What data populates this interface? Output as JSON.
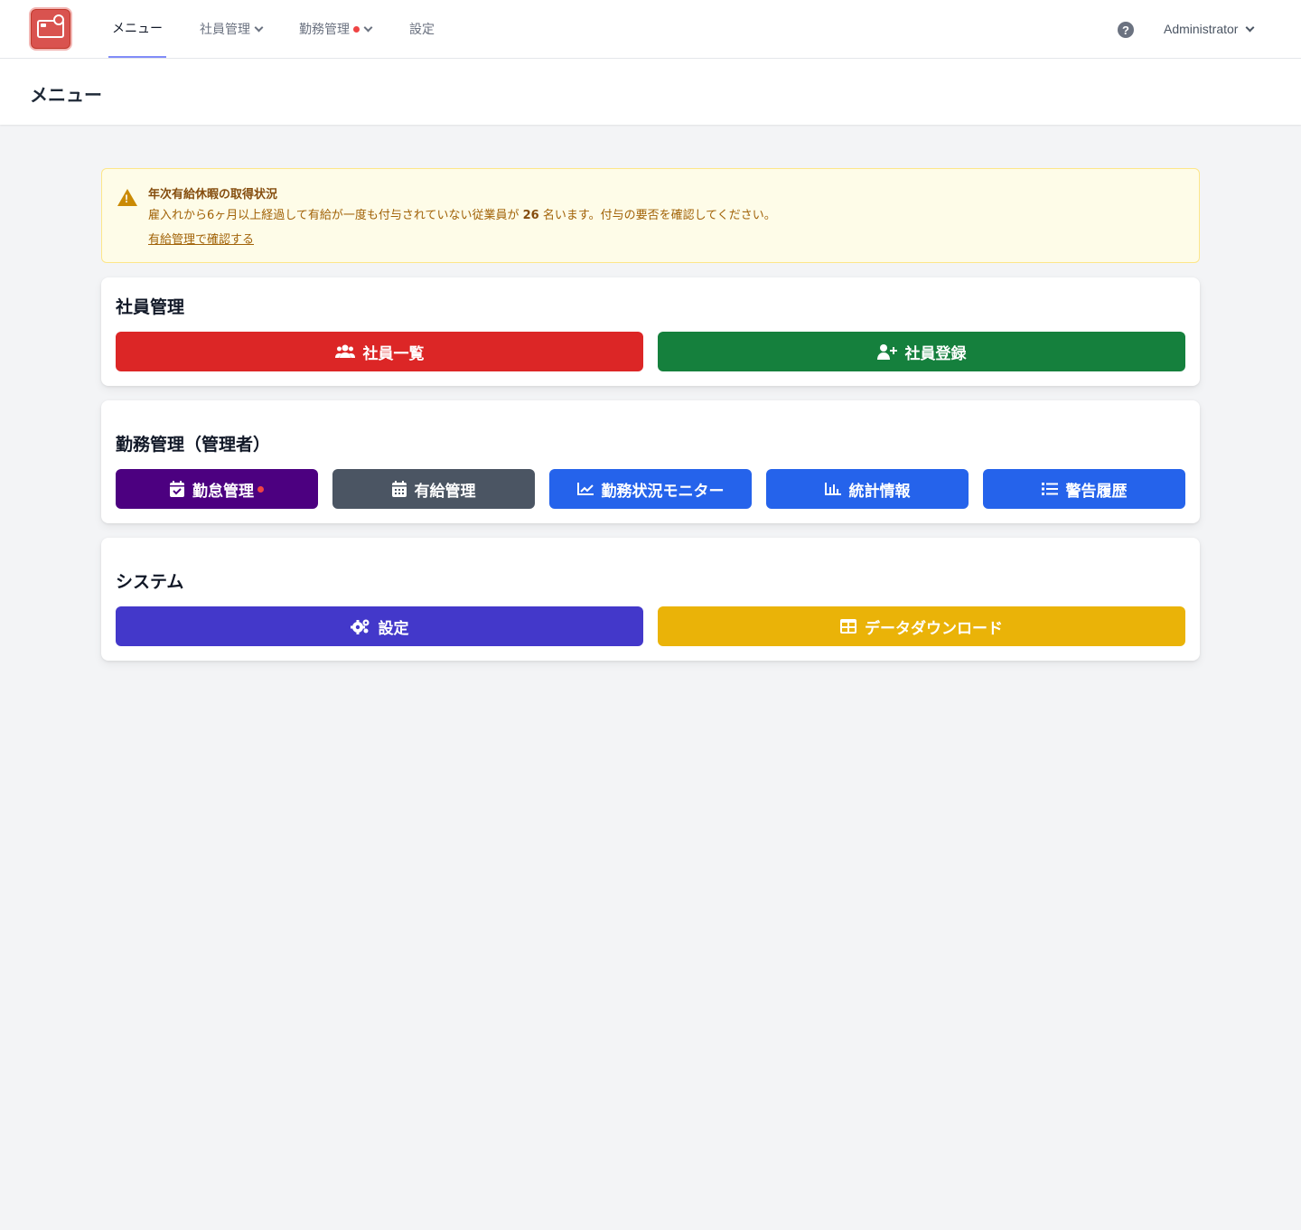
{
  "nav": {
    "logo": "credit-card-lock-logo",
    "items": [
      {
        "label": "メニュー"
      },
      {
        "label": "社員管理"
      },
      {
        "label": "勤務管理"
      },
      {
        "label": "設定"
      }
    ],
    "user": "Administrator",
    "help_glyph": "?"
  },
  "page": {
    "title": "メニュー"
  },
  "alert": {
    "title": "年次有給休暇の取得状況",
    "message_prefix": "雇入れから6ヶ月以上経過して有給が一度も付与されていない従業員が",
    "count": "26",
    "message_suffix": "名います。付与の要否を確認してください。",
    "link": "有給管理で確認する",
    "icon_glyph": "!",
    "color": "#fefce8"
  },
  "sections": {
    "employee": {
      "title": "社員管理",
      "buttons": [
        {
          "label": "社員一覧",
          "icon": "users-icon",
          "color": "#dc2626"
        },
        {
          "label": "社員登録",
          "icon": "user-plus-icon",
          "color": "#15803d"
        }
      ]
    },
    "attendance": {
      "title": "勤務管理（管理者）",
      "buttons": [
        {
          "label": "勤怠管理",
          "icon": "calendar-check-icon",
          "color": "#4c0080"
        },
        {
          "label": "有給管理",
          "icon": "calendar-icon",
          "color": "#4b5563"
        },
        {
          "label": "勤務状況モニター",
          "icon": "chart-line-icon",
          "color": "#2563eb"
        },
        {
          "label": "統計情報",
          "icon": "chart-bar-icon",
          "color": "#2563eb"
        },
        {
          "label": "警告履歴",
          "icon": "list-icon",
          "color": "#2563eb"
        }
      ]
    },
    "system": {
      "title": "システム",
      "buttons": [
        {
          "label": "設定",
          "icon": "cogs-icon",
          "color": "#4338ca"
        },
        {
          "label": "データダウンロード",
          "icon": "table-icon",
          "color": "#eab308"
        }
      ]
    }
  }
}
